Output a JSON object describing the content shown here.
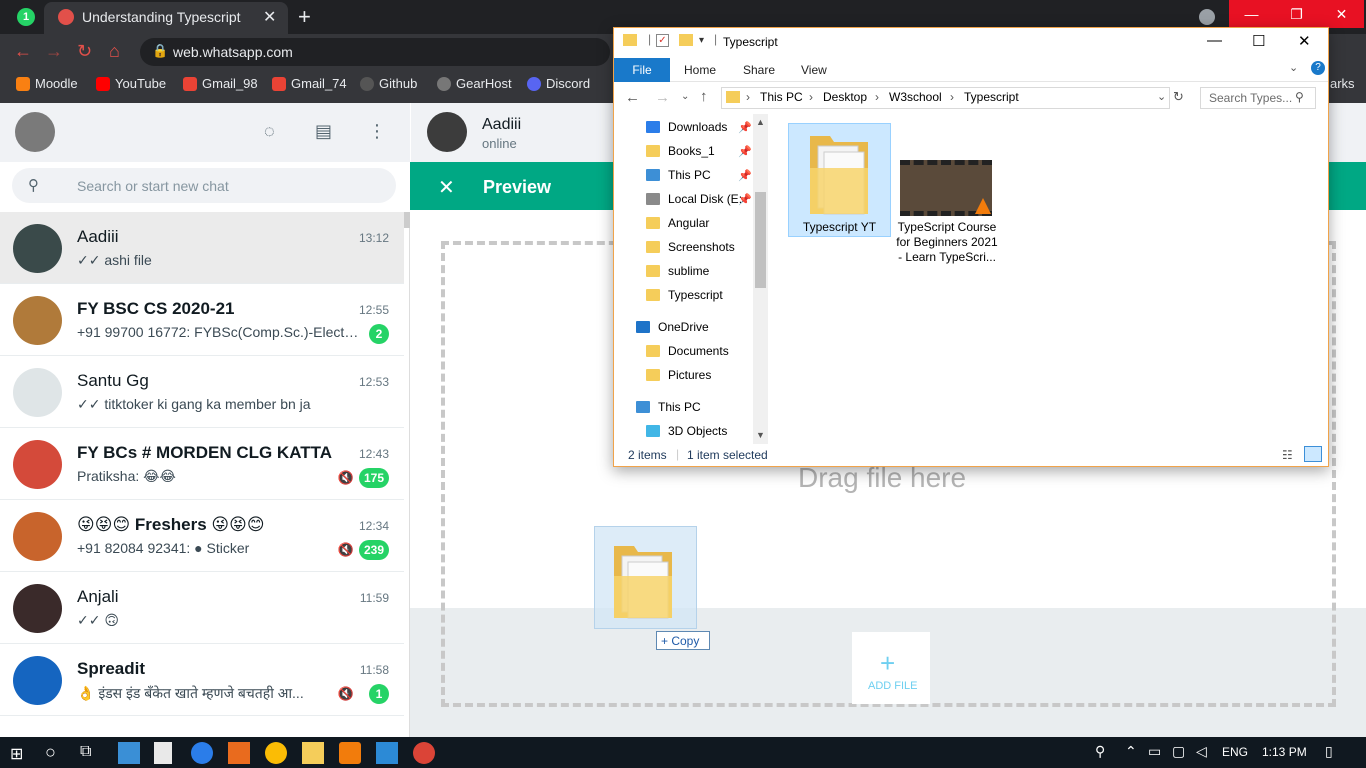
{
  "browser": {
    "tab_title": "Understanding Typescript",
    "wa_badge": "1",
    "url": "web.whatsapp.com",
    "bookmarks": [
      {
        "label": "Moodle",
        "color": "#f98012"
      },
      {
        "label": "YouTube",
        "color": "#ff0000"
      },
      {
        "label": "Gmail_98",
        "color": "#ea4335"
      },
      {
        "label": "Gmail_74",
        "color": "#ea4335"
      },
      {
        "label": "Github",
        "color": "#24292e"
      },
      {
        "label": "GearHost",
        "color": "#444444"
      },
      {
        "label": "Discord",
        "color": "#5865f2"
      }
    ],
    "bookmarks_overflow": "arks"
  },
  "whatsapp": {
    "search_placeholder": "Search or start new chat",
    "chats": [
      {
        "name": "Aadiii",
        "time": "13:12",
        "preview": "✓✓ ashi file",
        "badge": "",
        "muted": false,
        "bold": false,
        "active": true,
        "avatar_color": "#3a4a4a"
      },
      {
        "name": "FY BSC CS 2020-21",
        "time": "12:55",
        "preview": "+91 99700 16772: FYBSc(Comp.Sc.)-Electro...",
        "badge": "2",
        "muted": false,
        "bold": true,
        "active": false,
        "avatar_color": "#b07a3a"
      },
      {
        "name": "Santu Gg",
        "time": "12:53",
        "preview": "✓✓ titktoker ki gang ka member bn ja",
        "badge": "",
        "muted": false,
        "bold": false,
        "active": false,
        "avatar_color": "#dfe5e7"
      },
      {
        "name": "FY BCs # MORDEN CLG KATTA",
        "time": "12:43",
        "preview": "Pratiksha: 😂😂",
        "badge": "175",
        "muted": true,
        "bold": true,
        "active": false,
        "avatar_color": "#d44a3a"
      },
      {
        "name": "😜😝😊 Freshers 😜😝😊",
        "time": "12:34",
        "preview": "+91 82084 92341: ● Sticker",
        "badge": "239",
        "muted": true,
        "bold": true,
        "active": false,
        "avatar_color": "#c8642c"
      },
      {
        "name": "Anjali",
        "time": "11:59",
        "preview": "✓✓ 🙃",
        "badge": "",
        "muted": false,
        "bold": false,
        "active": false,
        "avatar_color": "#3a2a2a"
      },
      {
        "name": "Spreadit",
        "time": "11:58",
        "preview": "👌 इंडस इंड बँकेत खाते म्हणजे बचतही आ...",
        "badge": "1",
        "muted": true,
        "bold": true,
        "active": false,
        "avatar_color": "#1565c0"
      }
    ],
    "contact_name": "Aadiii",
    "contact_status": "online",
    "preview_title": "Preview",
    "drag_text": "Drag file here",
    "add_file_label": "ADD FILE",
    "copy_tooltip": "+ Copy"
  },
  "explorer": {
    "title": "Typescript",
    "ribbon_tabs": [
      "File",
      "Home",
      "Share",
      "View"
    ],
    "breadcrumb": [
      "This PC",
      "Desktop",
      "W3school",
      "Typescript"
    ],
    "search_placeholder": "Search Types...",
    "nav_items": [
      {
        "label": "Downloads",
        "pinned": true,
        "icon": "download-icon"
      },
      {
        "label": "Books_1",
        "pinned": true,
        "icon": "folder-icon"
      },
      {
        "label": "This PC",
        "pinned": true,
        "icon": "pc-icon"
      },
      {
        "label": "Local Disk (E:",
        "pinned": true,
        "icon": "drive-icon"
      },
      {
        "label": "Angular",
        "pinned": false,
        "icon": "folder-icon"
      },
      {
        "label": "Screenshots",
        "pinned": false,
        "icon": "folder-icon"
      },
      {
        "label": "sublime",
        "pinned": false,
        "icon": "folder-icon"
      },
      {
        "label": "Typescript",
        "pinned": false,
        "icon": "folder-icon"
      },
      {
        "label": "OneDrive",
        "pinned": false,
        "icon": "cloud-icon"
      },
      {
        "label": "Documents",
        "pinned": false,
        "icon": "folder-icon"
      },
      {
        "label": "Pictures",
        "pinned": false,
        "icon": "folder-icon"
      },
      {
        "label": "This PC",
        "pinned": false,
        "icon": "pc-icon"
      },
      {
        "label": "3D Objects",
        "pinned": false,
        "icon": "cube-icon"
      }
    ],
    "items": [
      {
        "label": "Typescript YT"
      },
      {
        "label": "TypeScript Course for Beginners 2021 - Learn TypeScri..."
      }
    ],
    "status_count": "2 items",
    "status_selected": "1 item selected"
  },
  "taskbar": {
    "lang": "ENG",
    "time": "1:13 PM"
  }
}
